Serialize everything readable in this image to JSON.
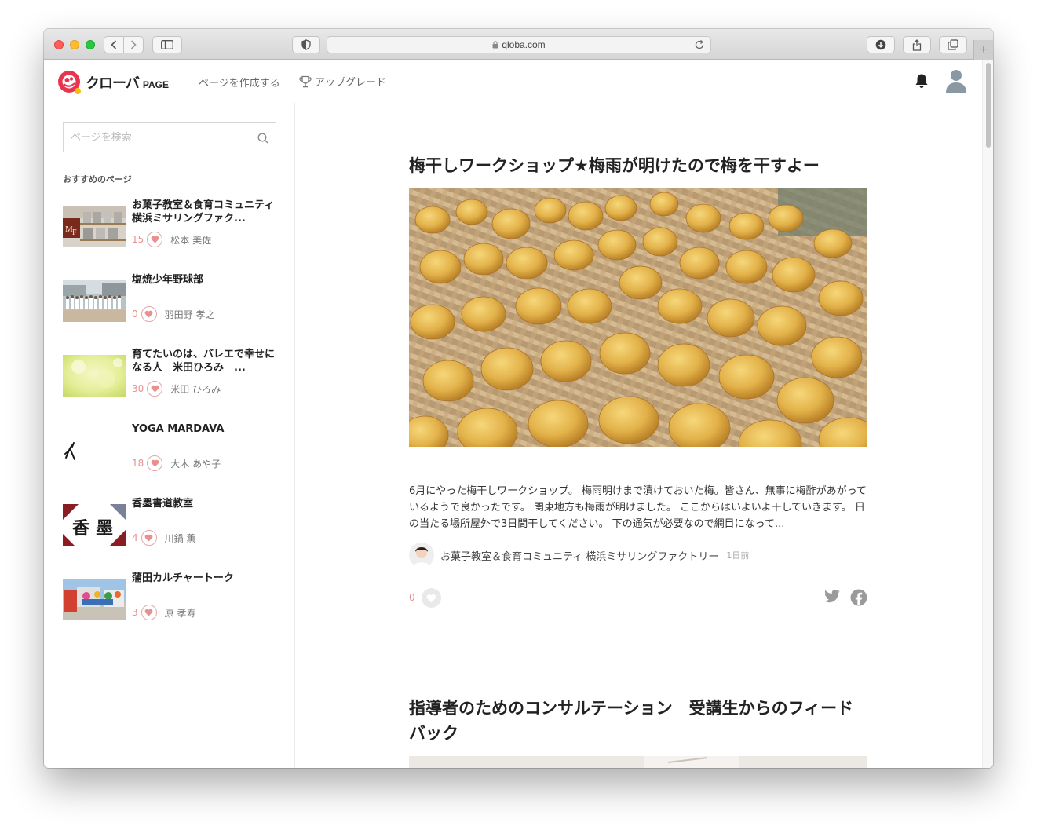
{
  "browser": {
    "url": "qloba.com"
  },
  "header": {
    "logo_text": "クローバ",
    "logo_sub": "PAGE",
    "create_page": "ページを作成する",
    "upgrade": "アップグレード"
  },
  "sidebar": {
    "search_placeholder": "ページを検索",
    "recommended_title": "おすすめのページ",
    "items": [
      {
        "name": "お菓子教室＆食育コミュニティ 横浜ミサリングファク...",
        "likes": "15",
        "author": "松本 美佐"
      },
      {
        "name": "塩焼少年野球部",
        "likes": "0",
        "author": "羽田野 孝之"
      },
      {
        "name": "育てたいのは、バレエで幸せになる人　米田ひろみ　...",
        "likes": "30",
        "author": "米田 ひろみ"
      },
      {
        "name": "YOGA MARDAVA",
        "likes": "18",
        "author": "大木 あや子"
      },
      {
        "name": "香墨書道教室",
        "likes": "4",
        "author": "川鍋 薫"
      },
      {
        "name": "蒲田カルチャートーク",
        "likes": "3",
        "author": "原 孝寿"
      }
    ]
  },
  "articles": [
    {
      "title": "梅干しワークショップ★梅雨が明けたので梅を干すよー",
      "excerpt": "6月にやった梅干しワークショップ。 梅雨明けまで漬けておいた梅。皆さん、無事に梅酢があがっているようで良かったです。 関東地方も梅雨が明けました。 ここからはいよいよ干していきます。 日の当たる場所屋外で3日間干してください。 下の通気が必要なので網目になって...",
      "author": "お菓子教室＆食育コミュニティ 横浜ミサリングファクトリー",
      "time": "1日前",
      "likes": "0"
    },
    {
      "title": "指導者のためのコンサルテーション　受講生からのフィードバック"
    }
  ],
  "colors": {
    "brand_red": "#e8344e",
    "like_pink": "#e8908f"
  }
}
